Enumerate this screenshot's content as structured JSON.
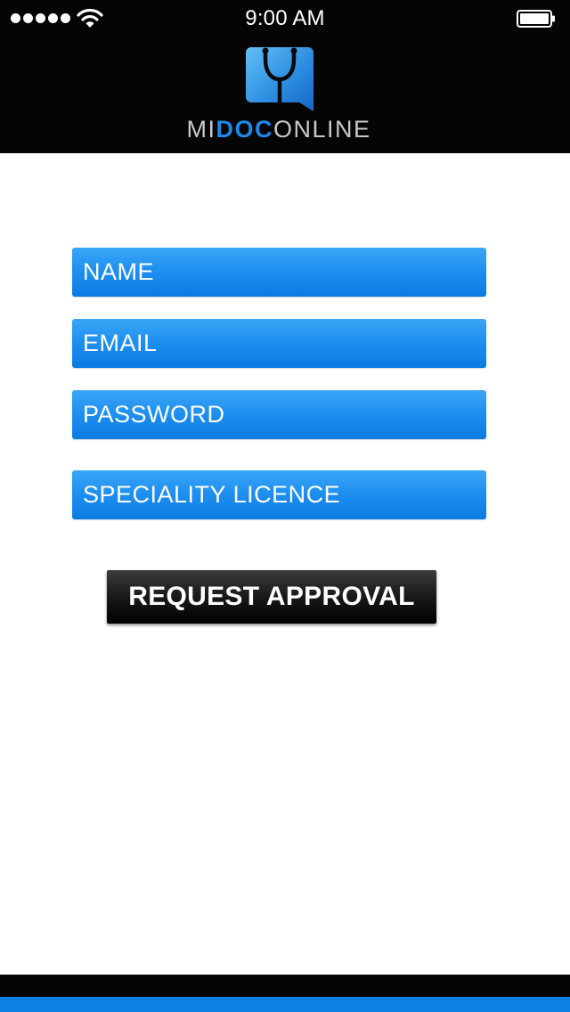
{
  "status_bar": {
    "time": "9:00 AM"
  },
  "header": {
    "brand_part1": "MI",
    "brand_part2": "DOC",
    "brand_part3": "ONLINE",
    "logo_icon": "stethoscope-chat-bubble-icon"
  },
  "form": {
    "name_placeholder": "NAME",
    "email_placeholder": "EMAIL",
    "password_placeholder": "PASSWORD",
    "licence_placeholder": "SPECIALITY LICENCE"
  },
  "request_button": {
    "label": "REQUEST APPROVAL"
  },
  "colors": {
    "field_blue": "#1d8ef0",
    "brand_blue": "#1e88e5",
    "header_black": "#050505",
    "footer_blue": "#0d80e3"
  }
}
